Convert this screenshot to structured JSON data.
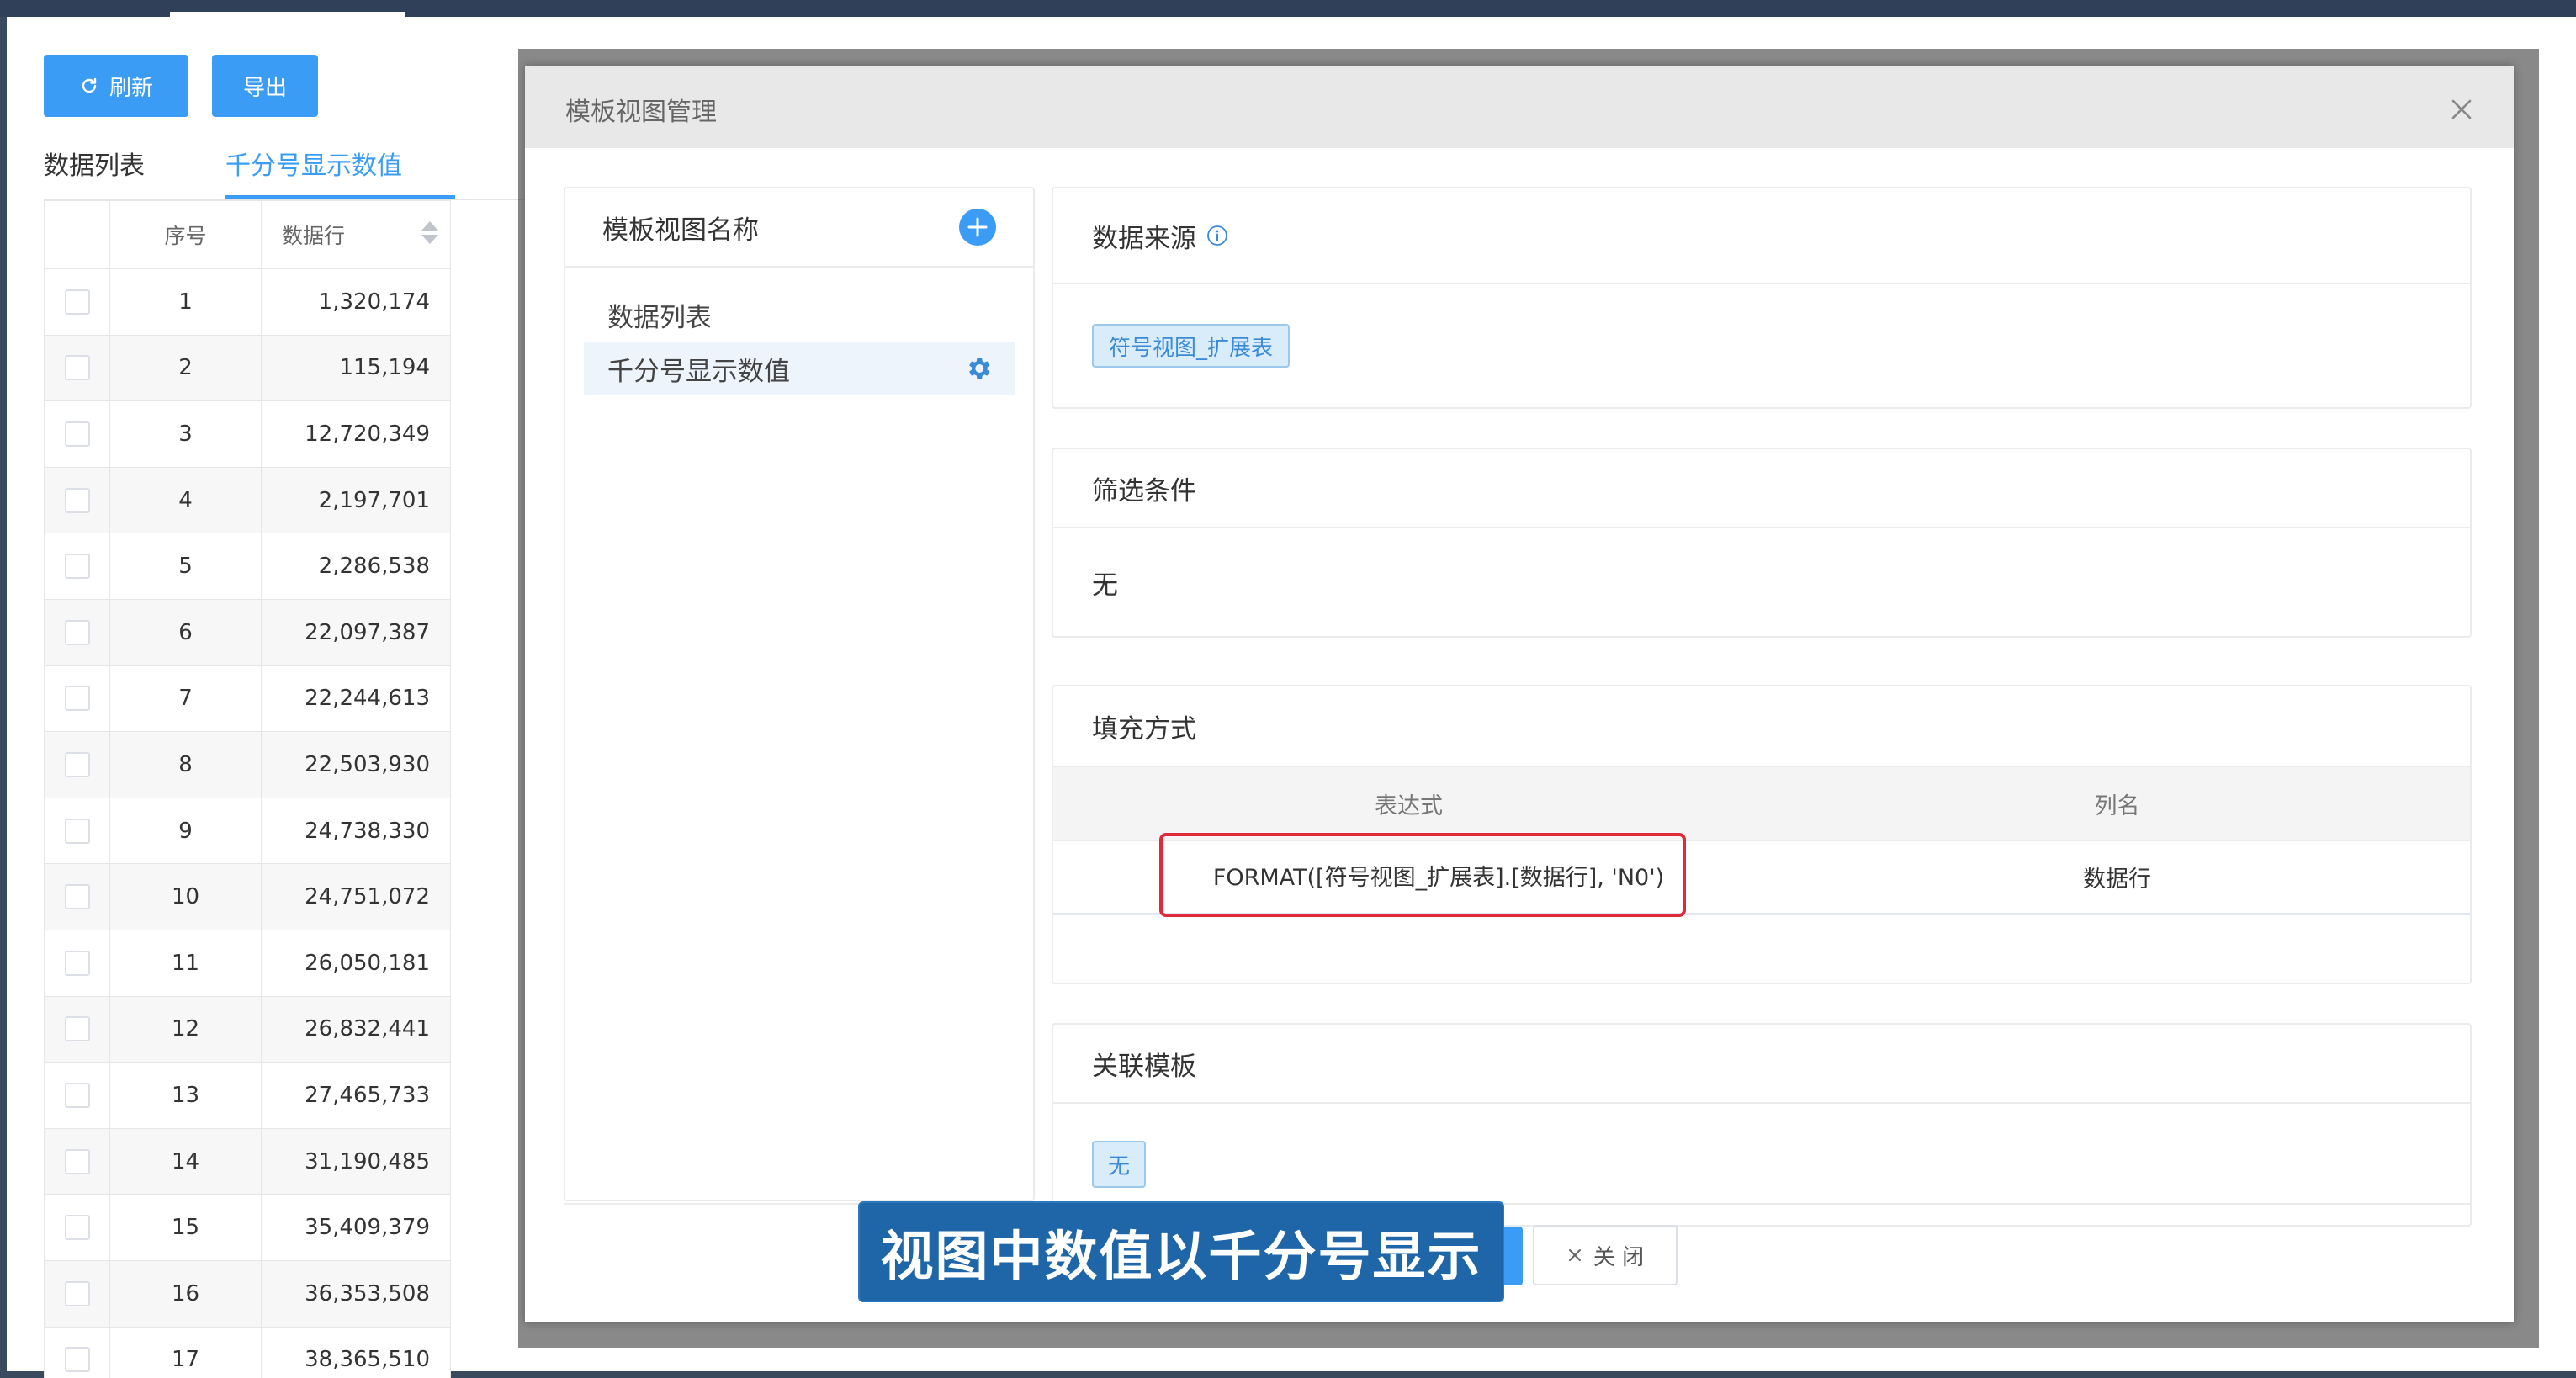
{
  "toolbar": {
    "refresh_label": "刷新",
    "export_label": "导出"
  },
  "tabs": [
    {
      "label": "数据列表",
      "active": false
    },
    {
      "label": "千分号显示数值",
      "active": true
    }
  ],
  "table": {
    "columns": [
      "序号",
      "数据行"
    ],
    "rows": [
      {
        "seq": "1",
        "value": "1,320,174"
      },
      {
        "seq": "2",
        "value": "115,194"
      },
      {
        "seq": "3",
        "value": "12,720,349"
      },
      {
        "seq": "4",
        "value": "2,197,701"
      },
      {
        "seq": "5",
        "value": "2,286,538"
      },
      {
        "seq": "6",
        "value": "22,097,387"
      },
      {
        "seq": "7",
        "value": "22,244,613"
      },
      {
        "seq": "8",
        "value": "22,503,930"
      },
      {
        "seq": "9",
        "value": "24,738,330"
      },
      {
        "seq": "10",
        "value": "24,751,072"
      },
      {
        "seq": "11",
        "value": "26,050,181"
      },
      {
        "seq": "12",
        "value": "26,832,441"
      },
      {
        "seq": "13",
        "value": "27,465,733"
      },
      {
        "seq": "14",
        "value": "31,190,485"
      },
      {
        "seq": "15",
        "value": "35,409,379"
      },
      {
        "seq": "16",
        "value": "36,353,508"
      },
      {
        "seq": "17",
        "value": "38,365,510"
      }
    ]
  },
  "modal": {
    "title": "模板视图管理",
    "left_panel": {
      "title": "模板视图名称",
      "items": [
        {
          "label": "数据列表",
          "active": false
        },
        {
          "label": "千分号显示数值",
          "active": true
        }
      ]
    },
    "data_source": {
      "title": "数据来源",
      "tag": "符号视图_扩展表"
    },
    "filter": {
      "title": "筛选条件",
      "value": "无"
    },
    "fill": {
      "title": "填充方式",
      "columns": [
        "表达式",
        "列名"
      ],
      "rows": [
        {
          "expression": "FORMAT([符号视图_扩展表].[数据行], 'N0')",
          "column": "数据行"
        }
      ]
    },
    "linked_template": {
      "title": "关联模板",
      "tag": "无"
    },
    "close_label": "关 闭"
  },
  "subtitle": "视图中数值以千分号显示",
  "colors": {
    "accent": "#3b9cf5",
    "highlight_border": "#e0293a",
    "caption_bg": "#1f66a8"
  }
}
